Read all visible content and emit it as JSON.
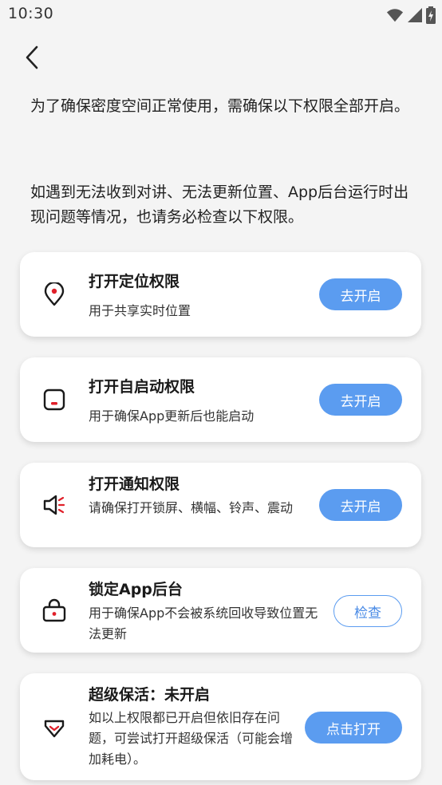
{
  "status_bar": {
    "time": "10:30"
  },
  "intro": {
    "paragraph1": "为了确保密度空间正常使用，需确保以下权限全部开启。",
    "paragraph2": "如遇到无法收到对讲、无法更新位置、App后台运行时出现问题等情况，也请务必检查以下权限。"
  },
  "cards": [
    {
      "title": "打开定位权限",
      "description": "用于共享实时位置",
      "button": "去开启",
      "icon": "location-pin-icon"
    },
    {
      "title": "打开自启动权限",
      "description": "用于确保App更新后也能启动",
      "button": "去开启",
      "icon": "auto-start-icon"
    },
    {
      "title": "打开通知权限",
      "description": "请确保打开锁屏、横幅、铃声、震动",
      "button": "去开启",
      "icon": "speaker-icon"
    },
    {
      "title": "锁定App后台",
      "description": "用于确保App不会被系统回收导致位置无法更新",
      "button": "检查",
      "icon": "lock-icon"
    },
    {
      "title": "超级保活：未开启",
      "description": "如以上权限都已开启但依旧存在问题，可尝试打开超级保活（可能会增加耗电）。",
      "button": "点击打开",
      "icon": "gem-icon"
    }
  ],
  "colors": {
    "accent": "#5b9cf0",
    "icon_red": "#e0202a",
    "background": "#f4f4f4"
  }
}
